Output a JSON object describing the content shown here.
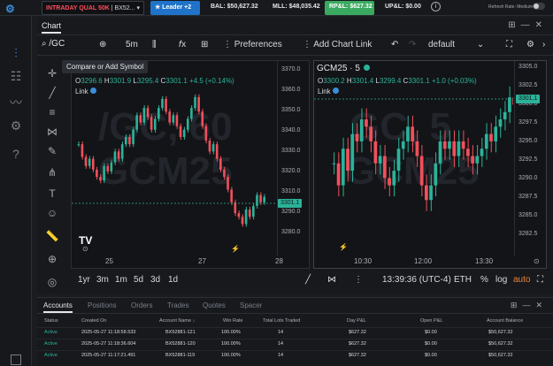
{
  "header": {
    "account_select": {
      "prefix": "INTRADAY QUAL 50K",
      "suffix": "| BX52..."
    },
    "leader_btn": "Leader +2",
    "bal": "BAL: $50,627.32",
    "mll": "MLL: $48,035.42",
    "rpl": "RP&L: $627.32",
    "upl": "UP&L: $0.00",
    "refresh_rate": "Refresh Rate: Medium"
  },
  "chart_panel": {
    "tab": "Chart",
    "symbol": "/GC",
    "timeframe": "5m",
    "preferences": "Preferences",
    "add_chart_link": "Add Chart Link",
    "layout": "default",
    "tooltip": "Compare or Add Symbol"
  },
  "chart_left": {
    "watermark_top": "/GC, 60",
    "watermark_main": "GCM25",
    "ohlc": {
      "o": "3296.6",
      "h": "3301.9",
      "l": "3295.4",
      "c": "3301.1",
      "chg": "+4.5 (+0.14%)"
    },
    "link_label": "Link",
    "y_ticks": [
      "3370.0",
      "3360.0",
      "3350.0",
      "3340.0",
      "3330.0",
      "3320.0",
      "3310.0",
      "3290.0",
      "3280.0"
    ],
    "price_label": "3301.1",
    "x_ticks": [
      "25",
      "27",
      "28"
    ],
    "candles": [
      3330,
      3323,
      3318,
      3322,
      3316,
      3312,
      3310,
      3318,
      3315,
      3320,
      3326,
      3322,
      3330,
      3334,
      3330,
      3338,
      3346,
      3342,
      3350,
      3345,
      3338,
      3344,
      3350,
      3355,
      3348,
      3342,
      3346,
      3340,
      3334,
      3338,
      3344,
      3350,
      3356,
      3348,
      3340,
      3332,
      3326,
      3330,
      3322,
      3316,
      3312,
      3305,
      3298,
      3292,
      3290,
      3286,
      3294,
      3290,
      3296,
      3302,
      3298,
      3301
    ]
  },
  "chart_right": {
    "title": "GCM25 · 5",
    "watermark_top": "GC, 5",
    "watermark_main": "GCM25",
    "ohlc": {
      "o": "3300.2",
      "h": "3301.4",
      "l": "3299.4",
      "c": "3301.1",
      "chg": "+1.0 (+0.03%)"
    },
    "link_label": "Link",
    "y_ticks": [
      "3305.0",
      "3302.5",
      "3300.0",
      "3297.5",
      "3295.0",
      "3292.5",
      "3290.0",
      "3287.5",
      "3285.0",
      "3282.5"
    ],
    "price_label": "3301.1",
    "x_ticks": [
      "10:30",
      "12:00",
      "13:30"
    ],
    "candles": [
      3293,
      3290,
      3295,
      3292,
      3297,
      3296,
      3299,
      3298,
      3296,
      3293,
      3294,
      3291,
      3290,
      3292,
      3295,
      3296,
      3298,
      3296,
      3294,
      3290,
      3288,
      3290,
      3293,
      3296,
      3295,
      3296,
      3294,
      3296,
      3295,
      3294,
      3293,
      3294,
      3295,
      3297,
      3296,
      3298,
      3299,
      3300,
      3302,
      3301
    ]
  },
  "bottom_toolbar": {
    "ranges": [
      "1yr",
      "3m",
      "1m",
      "5d",
      "3d",
      "1d"
    ],
    "time": "13:39:36 (UTC-4)",
    "session": "ETH",
    "pct": "%",
    "log": "log",
    "auto": "auto"
  },
  "accounts": {
    "tabs": [
      "Accounts",
      "Positions",
      "Orders",
      "Trades",
      "Quotes",
      "Spacer"
    ],
    "columns": [
      "Status",
      "Created On",
      "Account Name",
      "Win Rate",
      "Total Lots Traded",
      "Day P&L",
      "Open P&L",
      "Account Balance"
    ],
    "rows": [
      [
        "Active",
        "2025-05-27 11:18:58.533",
        "BX52881-121",
        "100.00%",
        "14",
        "$627.32",
        "$0.00",
        "$50,627.32"
      ],
      [
        "Active",
        "2025-05-27 11:18:36.604",
        "BX52881-120",
        "100.00%",
        "14",
        "$627.32",
        "$0.00",
        "$50,627.32"
      ],
      [
        "Active",
        "2025-05-27 11:17:21.491",
        "BX52881-119",
        "100.00%",
        "14",
        "$627.32",
        "$0.00",
        "$50,627.32"
      ]
    ]
  },
  "colors": {
    "up": "#2bb39a",
    "down": "#f0505c",
    "accent": "#1f73c8"
  }
}
